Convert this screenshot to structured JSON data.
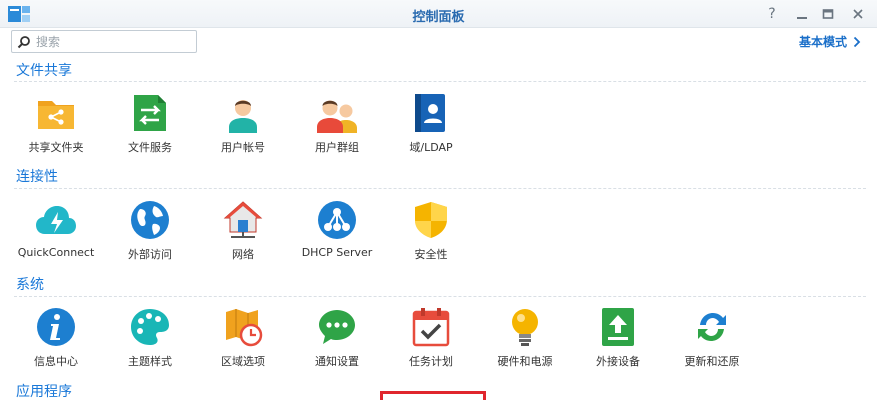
{
  "window": {
    "title": "控制面板"
  },
  "search": {
    "placeholder": "搜索"
  },
  "header": {
    "basic_mode_label": "基本模式"
  },
  "sections": [
    {
      "title": "文件共享",
      "items": [
        "共享文件夹",
        "文件服务",
        "用户帐号",
        "用户群组",
        "域/LDAP"
      ]
    },
    {
      "title": "连接性",
      "items": [
        "QuickConnect",
        "外部访问",
        "网络",
        "DHCP Server",
        "安全性"
      ]
    },
    {
      "title": "系统",
      "items": [
        "信息中心",
        "主题样式",
        "区域选项",
        "通知设置",
        "任务计划",
        "硬件和电源",
        "外接设备",
        "更新和还原"
      ]
    },
    {
      "title": "应用程序",
      "items": []
    }
  ],
  "colors": {
    "accent": "#1a78d8",
    "title_blue": "#2a6bb0",
    "highlight": "#e0262d"
  },
  "icons": {
    "sections": [
      [
        "shared-folder-icon",
        "file-services-icon",
        "user-icon",
        "group-icon",
        "domain-ldap-icon"
      ],
      [
        "quickconnect-icon",
        "external-access-icon",
        "network-icon",
        "dhcp-server-icon",
        "security-icon"
      ],
      [
        "info-center-icon",
        "theme-icon",
        "regional-options-icon",
        "notification-icon",
        "task-scheduler-icon",
        "hardware-power-icon",
        "external-devices-icon",
        "update-restore-icon"
      ]
    ]
  }
}
